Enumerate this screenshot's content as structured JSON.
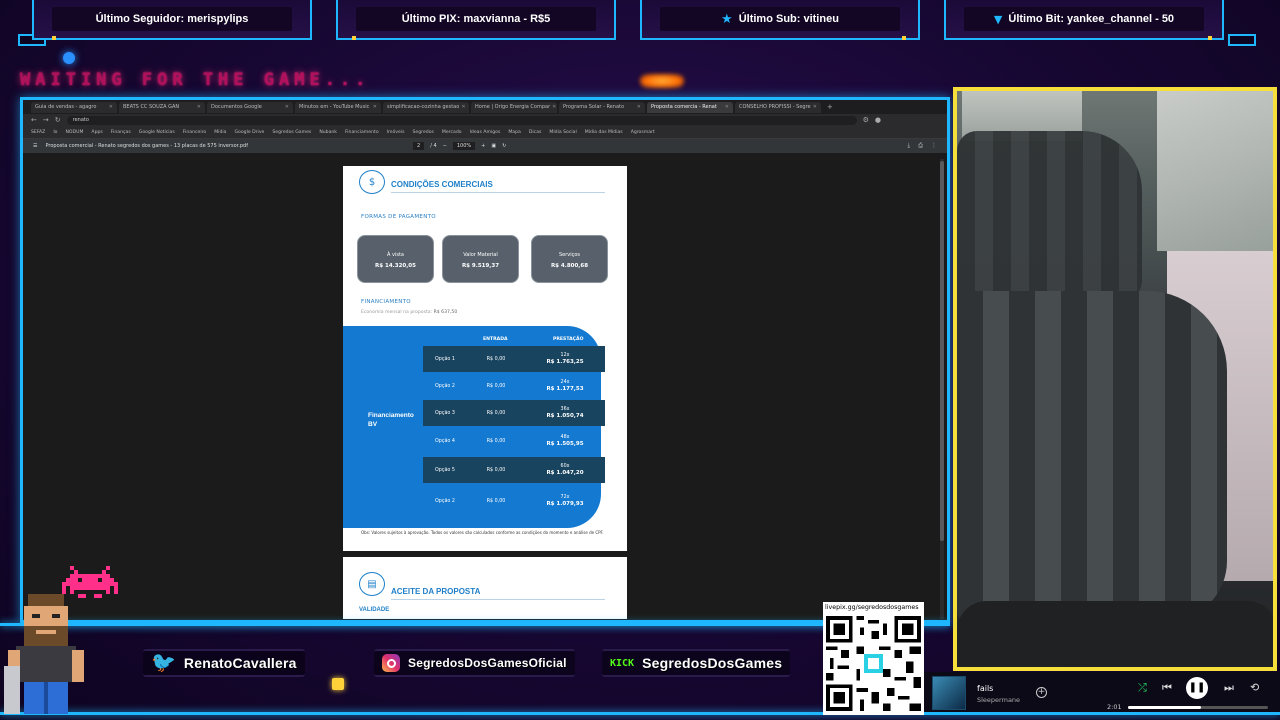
{
  "alerts": {
    "follower": "Último Seguidor: merispylips",
    "pix": "Último PIX: maxvianna - R$5",
    "sub": "Último Sub: vitineu",
    "bit": "Último Bit: yankee_channel - 50"
  },
  "waiting_text": "WAITING FOR THE GAME...",
  "browser": {
    "tabs": [
      "Guia de vendas - agagro",
      "BEATS CC SOUZA GAN",
      "Documentos Google",
      "Minutos em - YouTube Music",
      "simplificacao-cozinha gestao",
      "Home | Origo Energia Compar",
      "Programa Solar - Renato",
      "Proposta comercia - Renat",
      "CONSELHO PROFISSI - Segre"
    ],
    "url": "renato",
    "bookmarks": [
      "SEFAZ",
      "Io",
      "NODUM",
      "Apps",
      "Finanças",
      "Google Notícias",
      "Financeiro",
      "Mídia",
      "Google Drive",
      "Segredos Games",
      "Nubank",
      "Financiamento",
      "Imóveis",
      "Segredos",
      "Mercado",
      "Ideas Amigos",
      "Mapa",
      "Dicas",
      "Mídia Social",
      "Mídia das Mídias",
      "Agrosmart"
    ],
    "pdf_title": "Proposta comercial - Renato segredos dos games - 13 placas de 575 inversor.pdf",
    "page_num": "2",
    "page_total": "/ 4",
    "zoom": "100%"
  },
  "pdf": {
    "section1_title": "CONDIÇÕES COMERCIAIS",
    "payment_title": "FORMAS DE PAGAMENTO",
    "payment_boxes": [
      {
        "label": "À vista",
        "value": "R$ 14.320,05"
      },
      {
        "label": "Valor Material",
        "value": "R$ 9.519,37"
      },
      {
        "label": "Serviços",
        "value": "R$ 4.800,68"
      }
    ],
    "financing_title": "FINANCIAMENTO",
    "financing_note_label": "Economia mensal na proposta:",
    "financing_note_value": "R$ 637,50",
    "financing_label": "Financiamento BV",
    "col_entrada": "ENTRADA",
    "col_prestacao": "PRESTAÇÃO",
    "options": [
      {
        "option": "Opção 1",
        "entrada": "R$ 0,00",
        "parcelas": "12x",
        "valor": "R$ 1.763,25",
        "dark": true
      },
      {
        "option": "Opção 2",
        "entrada": "R$ 0,00",
        "parcelas": "24x",
        "valor": "R$ 1.177,53",
        "dark": false
      },
      {
        "option": "Opção 3",
        "entrada": "R$ 0,00",
        "parcelas": "36x",
        "valor": "R$ 1.050,74",
        "dark": true
      },
      {
        "option": "Opção 4",
        "entrada": "R$ 0,00",
        "parcelas": "48x",
        "valor": "R$ 1.505,95",
        "dark": false
      },
      {
        "option": "Opção 5",
        "entrada": "R$ 0,00",
        "parcelas": "60x",
        "valor": "R$ 1.047,20",
        "dark": true
      },
      {
        "option": "Opção 2",
        "entrada": "R$ 0,00",
        "parcelas": "72x",
        "valor": "R$ 1.079,93",
        "dark": false
      }
    ],
    "obs": "Obs: Valores sujeitos à aprovação. Todos os valores são calculados conforme as condições do momento e análise de CPF.",
    "section2_title": "ACEITE DA PROPOSTA",
    "validity": "VALIDADE"
  },
  "socials": {
    "twitter": "RenatoCavallera",
    "instagram": "SegredosDosGamesOficial",
    "kick_logo": "KICK",
    "kick": "SegredosDosGames"
  },
  "qr_url": "livepix.gg/segredosdosgames",
  "player": {
    "song": "fails",
    "artist": "Sleepermane",
    "time": "2:01",
    "progress": 0.52
  },
  "colors": {
    "accent": "#1fb7ff",
    "cam_border": "#f6df3a",
    "pdf_blue": "#1479d0",
    "waiting": "#e6146a"
  }
}
